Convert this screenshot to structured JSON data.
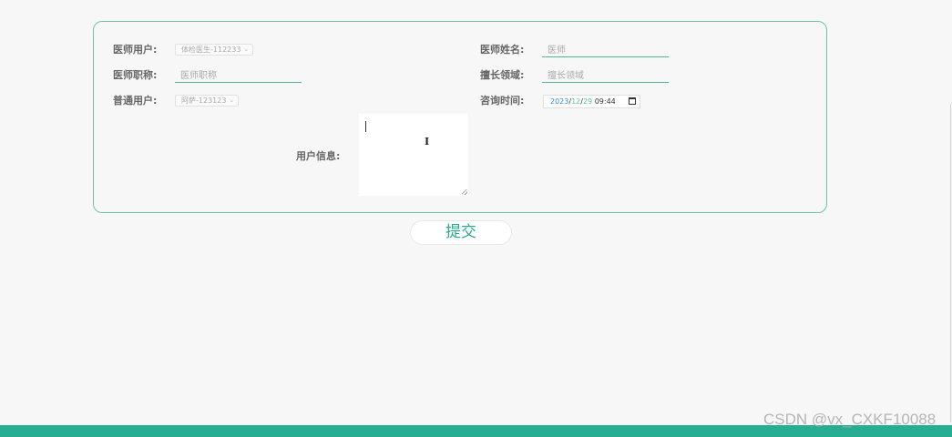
{
  "form": {
    "doctor_user_label": "医师用户:",
    "doctor_user_value": "体检医生-112233",
    "doctor_name_label": "医师姓名:",
    "doctor_name_placeholder": "医师",
    "doctor_title_label": "医师职称:",
    "doctor_title_placeholder": "医师职称",
    "specialty_label": "擅长领域:",
    "specialty_placeholder": "擅长领域",
    "normal_user_label": "普通用户:",
    "normal_user_value": "阿萨-123123",
    "consult_time_label": "咨询时间:",
    "consult_date": {
      "year": "2023",
      "month": "12",
      "day": "29",
      "time": "09:44",
      "separator": "/"
    },
    "user_info_label": "用户信息:",
    "user_info_value": ""
  },
  "submit_label": "提交",
  "watermark": "CSDN @vx_CXKF10088",
  "colors": {
    "accent": "#27ad92",
    "border": "#6cc4a9",
    "submit_text": "#29a88a"
  },
  "icons": {
    "dropdown": "chevron-down-icon",
    "calendar": "calendar-icon",
    "text_cursor": "i-beam-cursor-icon"
  }
}
